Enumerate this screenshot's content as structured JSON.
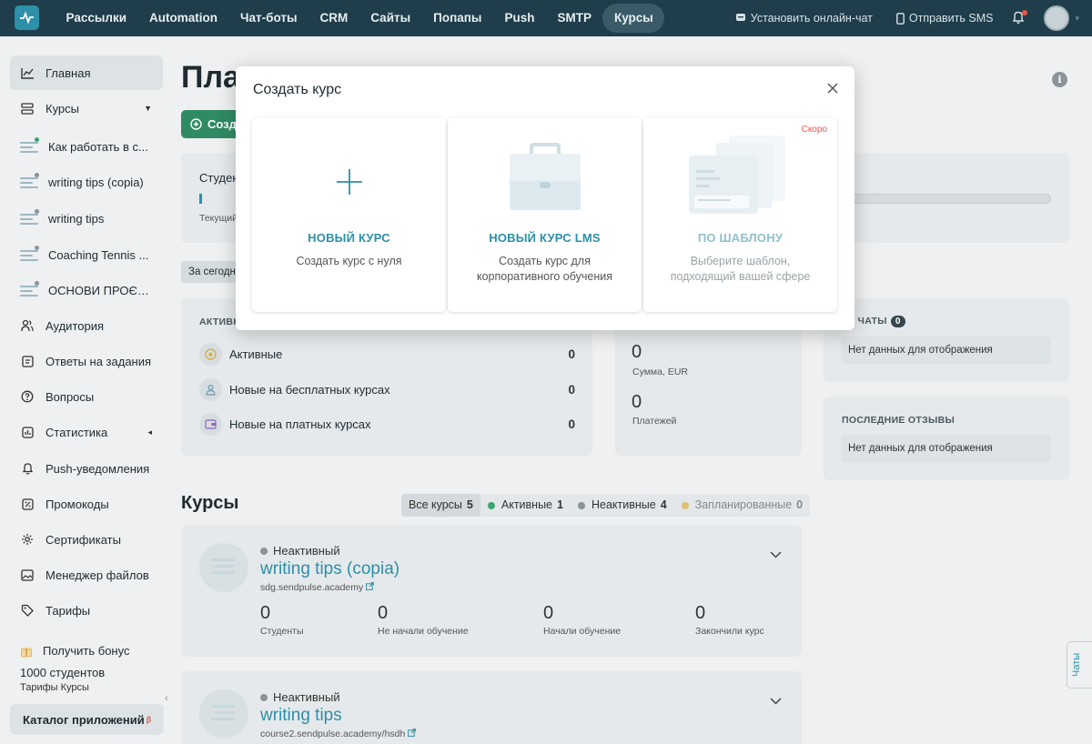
{
  "topnav": {
    "items": [
      "Рассылки",
      "Automation",
      "Чат-боты",
      "CRM",
      "Сайты",
      "Попапы",
      "Push",
      "SMTP",
      "Курсы"
    ],
    "active_index": 8,
    "install_chat": "Установить онлайн-чат",
    "send_sms": "Отправить SMS"
  },
  "sidebar": {
    "main": "Главная",
    "courses": "Курсы",
    "course_items": [
      {
        "label": "Как работать в с...",
        "dot_color": "#3aa66e"
      },
      {
        "label": "writing tips (copia)",
        "dot_color": "#8a9398"
      },
      {
        "label": "writing tips",
        "dot_color": "#8a9398"
      },
      {
        "label": "Coaching Tennis ...",
        "dot_color": "#8a9398"
      },
      {
        "label": "ОСНОВИ ПРОЄК...",
        "dot_color": "#8a9398"
      }
    ],
    "items": [
      "Аудитория",
      "Ответы на задания",
      "Вопросы",
      "Статистика",
      "Push-уведомления",
      "Промокоды",
      "Сертификаты",
      "Менеджер файлов",
      "Тарифы"
    ],
    "bonus_title": "Получить бонус",
    "bonus_line": "1000 студентов",
    "bonus_sub": "Тарифы Курсы",
    "catalog": "Каталог приложений",
    "catalog_mark": "β"
  },
  "main": {
    "title": "Пла",
    "create_label": "Созд",
    "students_label": "Студен",
    "current_label": "Текущий",
    "today_label": "За сегодн",
    "activity": {
      "title": "АКТИВНЫ",
      "rows": [
        {
          "label": "Активные",
          "value": "0"
        },
        {
          "label": "Новые на бесплатных курсах",
          "value": "0"
        },
        {
          "label": "Новые на платных курсах",
          "value": "0"
        }
      ]
    },
    "payments": {
      "sum_value": "0",
      "sum_label": "Сумма, EUR",
      "count_value": "0",
      "count_label": "Платежей"
    },
    "chats": {
      "title": "Е ЧАТЫ",
      "count": "0",
      "empty": "Нет данных для отображения"
    },
    "reviews": {
      "title": "ПОСЛЕДНИЕ ОТЗЫВЫ",
      "empty": "Нет данных для отображения"
    },
    "courses_title": "Курсы",
    "filters": [
      {
        "label": "Все курсы",
        "count": "5",
        "dot": ""
      },
      {
        "label": "Активные",
        "count": "1",
        "dot": "#3aa66e"
      },
      {
        "label": "Неактивные",
        "count": "4",
        "dot": "#8a9398"
      },
      {
        "label": "Запланированные",
        "count": "0",
        "dot": "#e0c070"
      }
    ],
    "course_cards": [
      {
        "status": "Неактивный",
        "name": "writing tips (copia)",
        "url": "sdg.sendpulse.academy",
        "stats": [
          {
            "value": "0",
            "label": "Студенты"
          },
          {
            "value": "0",
            "label": "Не начали обучение"
          },
          {
            "value": "0",
            "label": "Начали обучение"
          },
          {
            "value": "0",
            "label": "Закончили курс"
          }
        ]
      },
      {
        "status": "Неактивный",
        "name": "writing tips",
        "url": "course2.sendpulse.academy/hsdh"
      }
    ],
    "chats_tab": "Чаты"
  },
  "modal": {
    "title": "Создать курс",
    "options": [
      {
        "title": "НОВЫЙ КУРС",
        "desc": "Создать курс с нуля",
        "badge": ""
      },
      {
        "title": "НОВЫЙ КУРС LMS",
        "desc": "Создать курс для корпоративного обучения",
        "badge": ""
      },
      {
        "title": "ПО ШАБЛОНУ",
        "desc": "Выберите шаблон, подходящий вашей сфере",
        "badge": "Скоро"
      }
    ]
  }
}
